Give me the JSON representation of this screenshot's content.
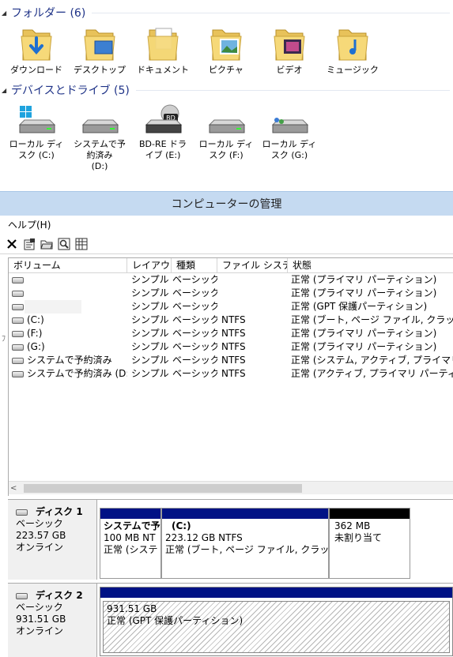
{
  "groups": {
    "folders": {
      "title": "フォルダー (6)"
    },
    "drives": {
      "title": "デバイスとドライブ (5)"
    }
  },
  "folders": [
    {
      "label": "ダウンロード",
      "icon": "download-folder-icon"
    },
    {
      "label": "デスクトップ",
      "icon": "desktop-folder-icon"
    },
    {
      "label": "ドキュメント",
      "icon": "documents-folder-icon"
    },
    {
      "label": "ピクチャ",
      "icon": "pictures-folder-icon"
    },
    {
      "label": "ビデオ",
      "icon": "videos-folder-icon"
    },
    {
      "label": "ミュージック",
      "icon": "music-folder-icon"
    }
  ],
  "drives": [
    {
      "line1": "ローカル ディ",
      "line2": "スク (C:)",
      "line3": "",
      "icon": "windows-drive-icon"
    },
    {
      "line1": "システムで予",
      "line2": "約済み",
      "line3": "(D:)",
      "icon": "hard-drive-icon"
    },
    {
      "line1": "BD-RE ドラ",
      "line2": "イブ (E:)",
      "line3": "",
      "icon": "bd-drive-icon",
      "badge": "BD"
    },
    {
      "line1": "ローカル ディ",
      "line2": "スク (F:)",
      "line3": "",
      "icon": "hard-drive-icon"
    },
    {
      "line1": "ローカル ディ",
      "line2": "スク (G:)",
      "line3": "",
      "icon": "users-drive-icon"
    }
  ],
  "window": {
    "title": "コンピューターの管理"
  },
  "menu": {
    "help": "ヘルプ(H)"
  },
  "volume_table": {
    "headers": [
      "ボリューム",
      "レイアウト",
      "種類",
      "ファイル システム",
      "状態"
    ],
    "rows": [
      [
        "",
        "シンプル",
        "ベーシック",
        "",
        "正常 (プライマリ パーティション)"
      ],
      [
        "",
        "シンプル",
        "ベーシック",
        "",
        "正常 (プライマリ パーティション)"
      ],
      [
        "",
        "シンプル",
        "ベーシック",
        "",
        "正常 (GPT 保護パーティション)"
      ],
      [
        "(C:)",
        "シンプル",
        "ベーシック",
        "NTFS",
        "正常 (ブート, ページ ファイル, クラッシュ ダン"
      ],
      [
        "(F:)",
        "シンプル",
        "ベーシック",
        "NTFS",
        "正常 (プライマリ パーティション)"
      ],
      [
        "(G:)",
        "シンプル",
        "ベーシック",
        "NTFS",
        "正常 (プライマリ パーティション)"
      ],
      [
        "システムで予約済み",
        "シンプル",
        "ベーシック",
        "NTFS",
        "正常 (システム, アクティブ, プライマリ パーテ"
      ],
      [
        "システムで予約済み (D:)",
        "シンプル",
        "ベーシック",
        "NTFS",
        "正常 (アクティブ, プライマリ パーティション)"
      ]
    ]
  },
  "disks": [
    {
      "name": "ディスク 1",
      "type": "ベーシック",
      "size": "223.57 GB",
      "status": "オンライン",
      "partitions": [
        {
          "title": "システムで予",
          "size": "100 MB NT",
          "status": "正常 (システ"
        },
        {
          "title": "(C:)",
          "size": "223.12 GB NTFS",
          "status": "正常 (ブート, ページ ファイル, クラッシュ ダ"
        },
        {
          "title": "",
          "size": "362 MB",
          "status": "未割り当て"
        }
      ]
    },
    {
      "name": "ディスク 2",
      "type": "ベーシック",
      "size": "931.51 GB",
      "status": "オンライン",
      "partitions": [
        {
          "title": "",
          "size": "931.51 GB",
          "status": "正常 (GPT 保護パーティション)"
        }
      ]
    }
  ],
  "colors": {
    "primary_bar": "#001285",
    "unallocated_bar": "#000000",
    "group_title": "#1e3287",
    "titlebar": "#c5daf1"
  }
}
